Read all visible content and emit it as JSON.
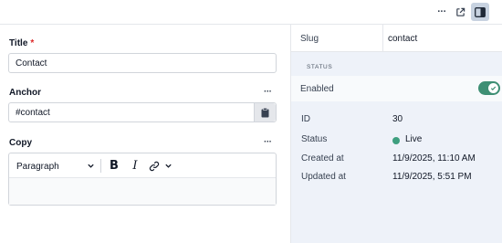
{
  "topbar": {
    "more_icon": "more-horizontal-icon",
    "external_icon": "external-link-icon",
    "panel_icon": "sidebar-panel-icon",
    "more_label": "···"
  },
  "form": {
    "title": {
      "label": "Title",
      "required_mark": "*",
      "value": "Contact"
    },
    "anchor": {
      "label": "Anchor",
      "menu": "···",
      "value": "#contact"
    },
    "copy": {
      "label": "Copy",
      "menu": "···",
      "toolbar": {
        "paragraph_select": "Paragraph",
        "bold": "B",
        "italic": "I"
      },
      "content": ""
    }
  },
  "sidebar": {
    "slug": {
      "key": "Slug",
      "value": "contact"
    },
    "section_title": "STATUS",
    "enabled": {
      "label": "Enabled",
      "on": true
    },
    "info": {
      "id_label": "ID",
      "id_value": "30",
      "status_label": "Status",
      "status_value": "Live",
      "created_label": "Created at",
      "created_value": "11/9/2025, 11:10 AM",
      "updated_label": "Updated at",
      "updated_value": "11/9/2025, 5:51 PM"
    }
  },
  "colors": {
    "accent_green": "#3e8f74",
    "status_live": "#3e9f7f",
    "required_red": "#dc2626",
    "panel_bg": "#eef2f9"
  }
}
